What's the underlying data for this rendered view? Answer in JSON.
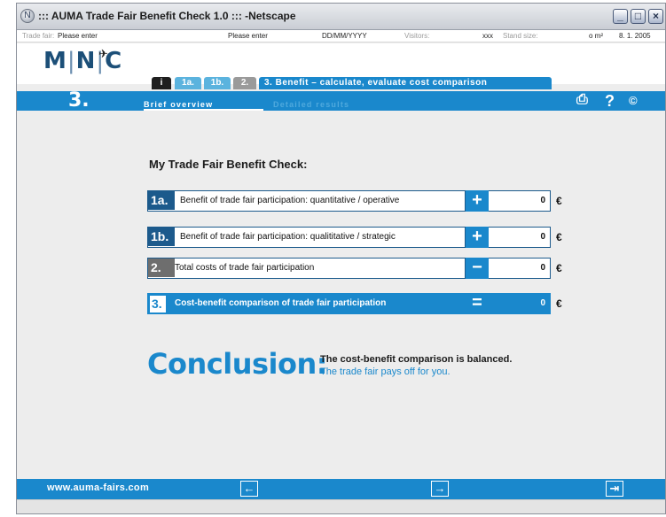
{
  "window": {
    "title": "::: AUMA Trade Fair Benefit Check 1.0 ::: -Netscape",
    "icon": "netscape-icon"
  },
  "infobar": {
    "trade_fair_label": "Trade fair:",
    "trade_fair_value": "Please enter",
    "field2": "Please enter",
    "date_placeholder": "DD/MM/YYYY",
    "visitors_label": "Visitors:",
    "visitors_value": "xxx",
    "stand_size_label": "Stand size:",
    "stand_size_value": "o m²",
    "date": "8. 1. 2005"
  },
  "header": {
    "logo": {
      "m": "M",
      "n": "N",
      "c": "C",
      "sep": "|"
    },
    "tabs": [
      {
        "label": "i"
      },
      {
        "label": "1a."
      },
      {
        "label": "1b."
      },
      {
        "label": "2."
      },
      {
        "label": "3. Benefit – calculate, evaluate cost comparison"
      }
    ]
  },
  "nav": {
    "step": "3.",
    "subtabs": [
      "Brief overview",
      "Detailed results"
    ],
    "print_icon": "print-icon",
    "help_label": "?",
    "copyright_label": "©"
  },
  "main": {
    "title": "My Trade Fair Benefit Check:",
    "rows": [
      {
        "num": "1a.",
        "label": "Benefit of trade fair participation: quantitative / operative",
        "op": "+",
        "value": "0",
        "currency": "€"
      },
      {
        "num": "1b.",
        "label": "Benefit of trade fair participation: qualititative / strategic",
        "op": "+",
        "value": "0",
        "currency": "€"
      },
      {
        "num": "2.",
        "label": "Total costs of trade fair participation",
        "op": "−",
        "value": "0",
        "currency": "€"
      },
      {
        "num": "3.",
        "label": "Cost-benefit comparison of trade fair participation",
        "op": "=",
        "value": "0",
        "currency": "€"
      }
    ],
    "conclusion_heading": "Conclusion:",
    "conclusion_line1": "The cost-benefit comparison is balanced.",
    "conclusion_line2": "The trade fair pays off for you."
  },
  "footer": {
    "url": "www.auma-fairs.com",
    "back_icon": "arrow-left-icon",
    "forward_icon": "arrow-right-icon",
    "exit_icon": "exit-icon"
  },
  "colors": {
    "accent": "#1a88cc",
    "dark_blue": "#1c5a8c",
    "grey": "#6e6e6e"
  }
}
